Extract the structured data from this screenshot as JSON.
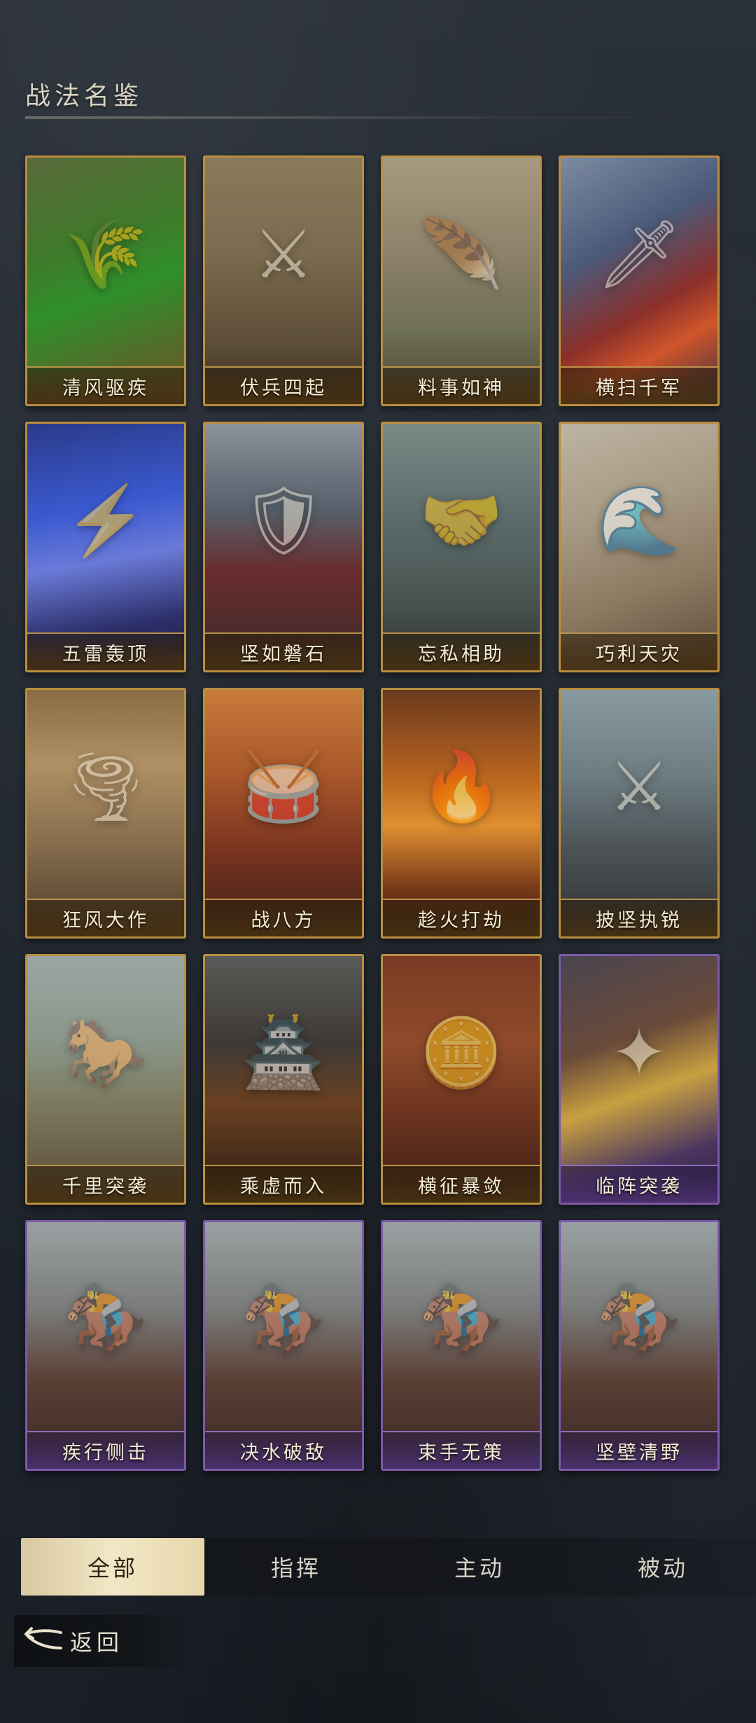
{
  "page": {
    "title": "战法名鉴"
  },
  "cards": [
    {
      "name": "清风驱疾",
      "rarity": "gold",
      "icon": "wind-grass-icon",
      "glyph": "🌾",
      "art": "linear-gradient(160deg,#5a6a3c 0%,#3f7a2a 35%,#2f8f2a 55%,#556a2a 80%,#6c5c2c 100%)"
    },
    {
      "name": "伏兵四起",
      "rarity": "gold",
      "icon": "ambush-troops-icon",
      "glyph": "⚔",
      "art": "linear-gradient(180deg,#8a7a5c 0%,#7a6a4e 40%,#5d4e38 75%,#3d3222 100%)"
    },
    {
      "name": "料事如神",
      "rarity": "gold",
      "icon": "feather-fan-icon",
      "glyph": "🪶",
      "art": "linear-gradient(180deg,#a79a80 0%,#8c8068 40%,#6e7054 70%,#4a4632 100%)"
    },
    {
      "name": "横扫千军",
      "rarity": "gold",
      "icon": "sweeping-blade-icon",
      "glyph": "🗡",
      "art": "linear-gradient(150deg,#7c8ba0 0%,#4b5a7a 35%,#8a2f2a 60%,#d0552a 75%,#3a3044 100%)"
    },
    {
      "name": "五雷轰顶",
      "rarity": "gold",
      "icon": "lightning-icon",
      "glyph": "⚡",
      "art": "linear-gradient(170deg,#2a3a8a 0%,#3b5ad0 35%,#6a7ad8 55%,#2c2f6a 80%,#1e2040 100%)"
    },
    {
      "name": "坚如磐石",
      "rarity": "gold",
      "icon": "shield-wall-icon",
      "glyph": "🛡",
      "art": "linear-gradient(180deg,#8a939c 0%,#56606a 35%,#6a2c2e 60%,#3a2a2a 100%)"
    },
    {
      "name": "忘私相助",
      "rarity": "gold",
      "icon": "helping-hand-icon",
      "glyph": "🤝",
      "art": "linear-gradient(180deg,#7a8a86 0%,#5a6a6a 40%,#4a5552 70%,#32352e 100%)"
    },
    {
      "name": "巧利天灾",
      "rarity": "gold",
      "icon": "flood-icon",
      "glyph": "🌊",
      "art": "linear-gradient(160deg,#bcb4a2 0%,#a89a84 35%,#8c7a62 65%,#5c4a3a 100%)"
    },
    {
      "name": "狂风大作",
      "rarity": "gold",
      "icon": "tornado-icon",
      "glyph": "🌪",
      "art": "linear-gradient(180deg,#8a6c44 0%,#b09064 30%,#8a7050 60%,#4e3c28 100%)"
    },
    {
      "name": "战八方",
      "rarity": "gold",
      "icon": "war-drum-icon",
      "glyph": "🥁",
      "art": "linear-gradient(180deg,#c87a3a 0%,#a8562a 35%,#7a3420 65%,#3c2018 100%)"
    },
    {
      "name": "趁火打劫",
      "rarity": "gold",
      "icon": "fire-icon",
      "glyph": "🔥",
      "art": "linear-gradient(180deg,#6a3a1e 0%,#b8641e 35%,#e09030 55%,#7a3a1a 80%,#301a10 100%)"
    },
    {
      "name": "披坚执锐",
      "rarity": "gold",
      "icon": "armored-general-icon",
      "glyph": "⚔",
      "art": "linear-gradient(180deg,#8a9aa2 0%,#6c7c80 35%,#4c5256 65%,#2e3032 100%)"
    },
    {
      "name": "千里突袭",
      "rarity": "gold",
      "icon": "cavalry-icon",
      "glyph": "🐎",
      "art": "linear-gradient(180deg,#9aa6a2 0%,#8a968a 35%,#7c7a5e 60%,#5a4a34 100%)"
    },
    {
      "name": "乘虚而入",
      "rarity": "gold",
      "icon": "torch-infiltration-icon",
      "glyph": "🏯",
      "art": "linear-gradient(180deg,#5a5a58 0%,#3e3a36 35%,#6a4020 60%,#2a1e14 100%)"
    },
    {
      "name": "横征暴敛",
      "rarity": "gold",
      "icon": "coins-icon",
      "glyph": "🪙",
      "art": "linear-gradient(180deg,#7a3a24 0%,#8e4a2a 35%,#6c3420 65%,#3a1c14 100%)"
    },
    {
      "name": "临阵突袭",
      "rarity": "purple",
      "icon": "glowing-spear-icon",
      "glyph": "✦",
      "art": "linear-gradient(160deg,#4a4550 0%,#6a4a3a 35%,#c8a040 55%,#4a3560 80%,#2a2038 100%)"
    },
    {
      "name": "疾行侧击",
      "rarity": "purple",
      "icon": "mounted-general-icon",
      "glyph": "🏇",
      "art": "linear-gradient(180deg,#9aa0a2 0%,#7a7c7a 35%,#5a3e34 65%,#3a2a26 100%)"
    },
    {
      "name": "决水破敌",
      "rarity": "purple",
      "icon": "mounted-general-icon",
      "glyph": "🏇",
      "art": "linear-gradient(180deg,#9aa0a2 0%,#7a7c7a 35%,#5a3e34 65%,#3a2a26 100%)"
    },
    {
      "name": "束手无策",
      "rarity": "purple",
      "icon": "mounted-general-icon",
      "glyph": "🏇",
      "art": "linear-gradient(180deg,#9aa0a2 0%,#7a7c7a 35%,#5a3e34 65%,#3a2a26 100%)"
    },
    {
      "name": "坚壁清野",
      "rarity": "purple",
      "icon": "mounted-general-icon",
      "glyph": "🏇",
      "art": "linear-gradient(180deg,#9aa0a2 0%,#7a7c7a 35%,#5a3e34 65%,#3a2a26 100%)"
    }
  ],
  "filters": {
    "selected": "全部",
    "tabs": [
      {
        "label": "全部",
        "key": "all"
      },
      {
        "label": "指挥",
        "key": "command"
      },
      {
        "label": "主动",
        "key": "active"
      },
      {
        "label": "被动",
        "key": "passive"
      }
    ]
  },
  "back": {
    "label": "返回",
    "icon": "back-arrow-icon"
  },
  "colors": {
    "gold_border": "#b88e3f",
    "purple_border": "#7a5aa8",
    "active_tab": "#e9dcb4"
  }
}
